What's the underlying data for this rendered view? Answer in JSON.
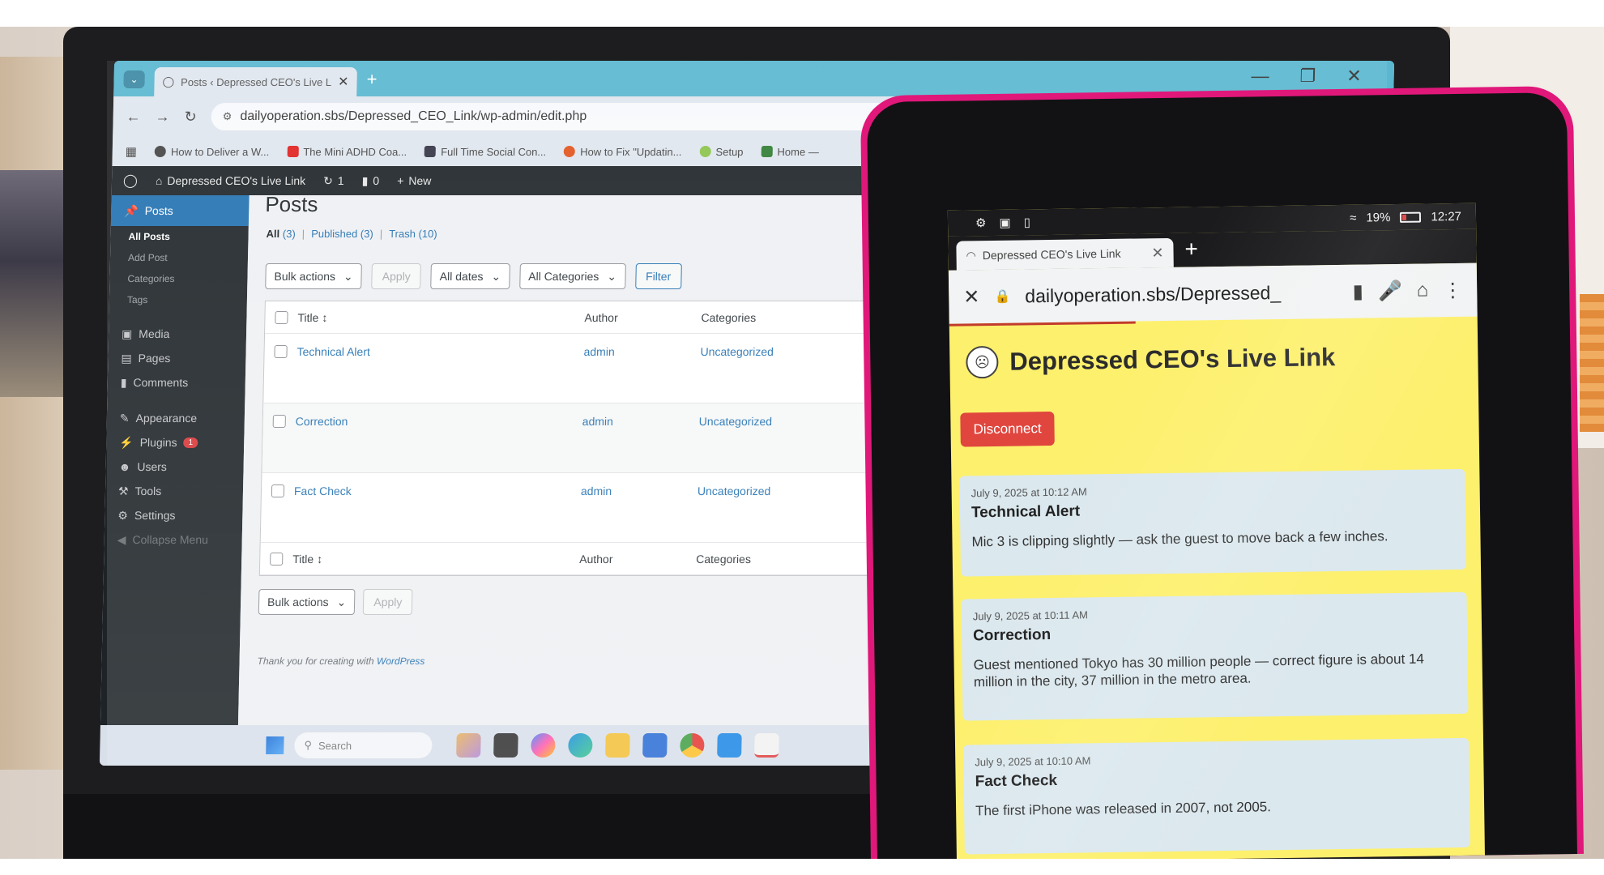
{
  "laptop": {
    "chrome": {
      "tab_title": "Posts ‹ Depressed CEO's Live Li",
      "url": "dailyoperation.sbs/Depressed_CEO_Link/wp-admin/edit.php",
      "bookmarks": [
        "How to Deliver a W...",
        "The Mini ADHD Coa...",
        "Full Time Social Con...",
        "How to Fix \"Updatin...",
        "Setup",
        "Home —"
      ]
    },
    "wp": {
      "adminbar": {
        "site_name": "Depressed CEO's Live Link",
        "updates": "1",
        "comments": "0",
        "new": "New"
      },
      "sidebar": {
        "posts": "Posts",
        "sub": [
          "All Posts",
          "Add Post",
          "Categories",
          "Tags"
        ],
        "media": "Media",
        "pages": "Pages",
        "comments": "Comments",
        "appearance": "Appearance",
        "plugins": "Plugins",
        "plugins_badge": "1",
        "users": "Users",
        "tools": "Tools",
        "settings": "Settings",
        "collapse": "Collapse Menu"
      },
      "heading": "Posts",
      "views": {
        "all": "All",
        "all_count": "(3)",
        "published": "Published",
        "published_count": "(3)",
        "trash": "Trash",
        "trash_count": "(10)"
      },
      "filters": {
        "bulk": "Bulk actions",
        "apply": "Apply",
        "dates": "All dates",
        "categories": "All Categories",
        "filter": "Filter"
      },
      "table": {
        "headers": {
          "title": "Title",
          "author": "Author",
          "categories": "Categories"
        },
        "rows": [
          {
            "title": "Technical Alert",
            "author": "admin",
            "category": "Uncategorized"
          },
          {
            "title": "Correction",
            "author": "admin",
            "category": "Uncategorized"
          },
          {
            "title": "Fact Check",
            "author": "admin",
            "category": "Uncategorized"
          }
        ]
      },
      "footer": {
        "text": "Thank you for creating with",
        "link": "WordPress"
      }
    },
    "taskbar": {
      "search_placeholder": "Search"
    }
  },
  "tablet": {
    "status": {
      "battery": "19%",
      "time": "12:27"
    },
    "tab_title": "Depressed CEO's Live Link",
    "url": "dailyoperation.sbs/Depressed_",
    "site_title": "Depressed CEO's Live Link",
    "disconnect_label": "Disconnect",
    "posts": [
      {
        "date": "July 9, 2025 at 10:12 AM",
        "title": "Technical Alert",
        "body": "Mic 3 is clipping slightly — ask the guest to move back a few inches."
      },
      {
        "date": "July 9, 2025 at 10:11 AM",
        "title": "Correction",
        "body": "Guest mentioned Tokyo has 30 million people — correct figure is about 14 million in the city, 37 million in the metro area."
      },
      {
        "date": "July 9, 2025 at 10:10 AM",
        "title": "Fact Check",
        "body": "The first iPhone was released in 2007, not 2005."
      }
    ]
  },
  "colors": {
    "tablet_case": "#e0187a",
    "page_bg": "#fdf06d",
    "card_bg": "#dbe8ee",
    "disconnect": "#e0463e",
    "wp_admin": "#1d2327",
    "wp_blue": "#2271b1"
  }
}
